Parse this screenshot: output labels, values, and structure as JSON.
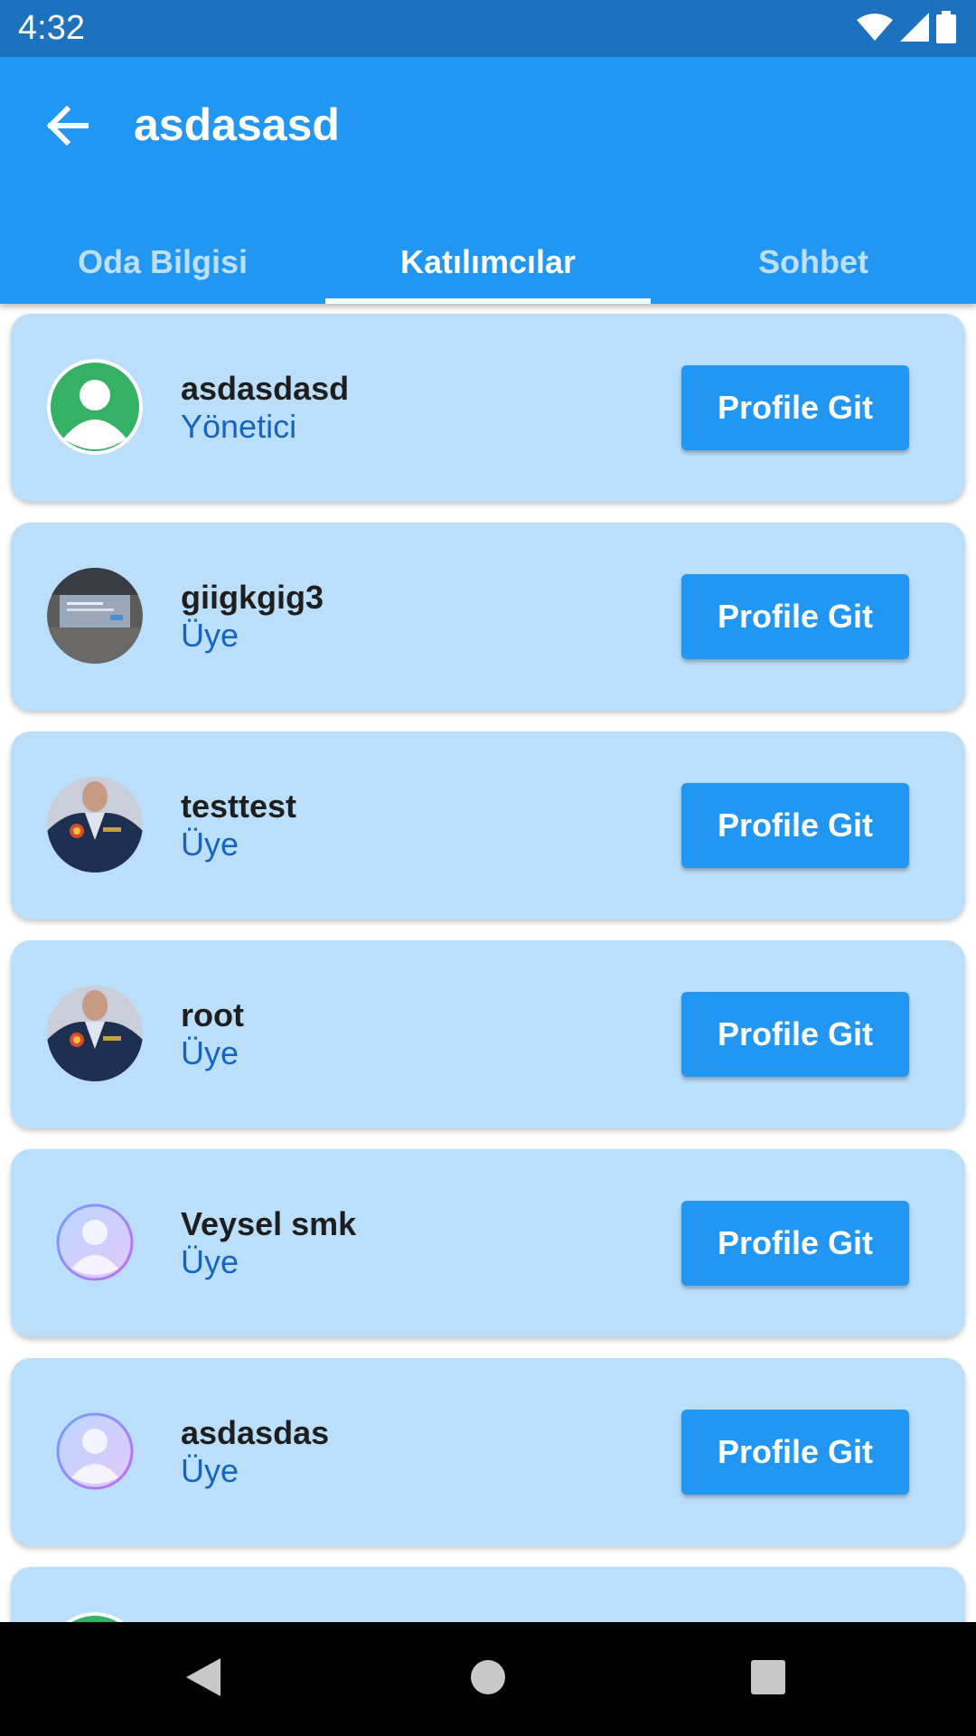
{
  "status_bar": {
    "time": "4:32",
    "icons": [
      "wifi-icon",
      "cell-signal-icon",
      "battery-icon"
    ]
  },
  "app_bar": {
    "title": "asdasasd",
    "back_icon": "arrow-left-icon"
  },
  "tabs": [
    {
      "label": "Oda Bilgisi",
      "active": false
    },
    {
      "label": "Katılımcılar",
      "active": true
    },
    {
      "label": "Sohbet",
      "active": false
    }
  ],
  "participants": [
    {
      "name": "asdasdasd",
      "role": "Yönetici",
      "button_label": "Profile Git",
      "avatar": "default-avatar-green"
    },
    {
      "name": "giigkgig3",
      "role": "Üye",
      "button_label": "Profile Git",
      "avatar": "photo-screen"
    },
    {
      "name": "testtest",
      "role": "Üye",
      "button_label": "Profile Git",
      "avatar": "photo-person-jacket"
    },
    {
      "name": "root",
      "role": "Üye",
      "button_label": "Profile Git",
      "avatar": "photo-person-jacket"
    },
    {
      "name": "Veysel smk",
      "role": "Üye",
      "button_label": "Profile Git",
      "avatar": "default-avatar-gradient"
    },
    {
      "name": "asdasdas",
      "role": "Üye",
      "button_label": "Profile Git",
      "avatar": "default-avatar-gradient"
    }
  ],
  "colors": {
    "app_bar": "#2196f3",
    "status_bar": "#1c72bd",
    "card": "#bbdefb",
    "role_text": "#1565c0",
    "button": "#2196f3"
  },
  "nav_bar": {
    "icons": [
      "back-triangle-icon",
      "home-circle-icon",
      "recents-square-icon"
    ]
  }
}
